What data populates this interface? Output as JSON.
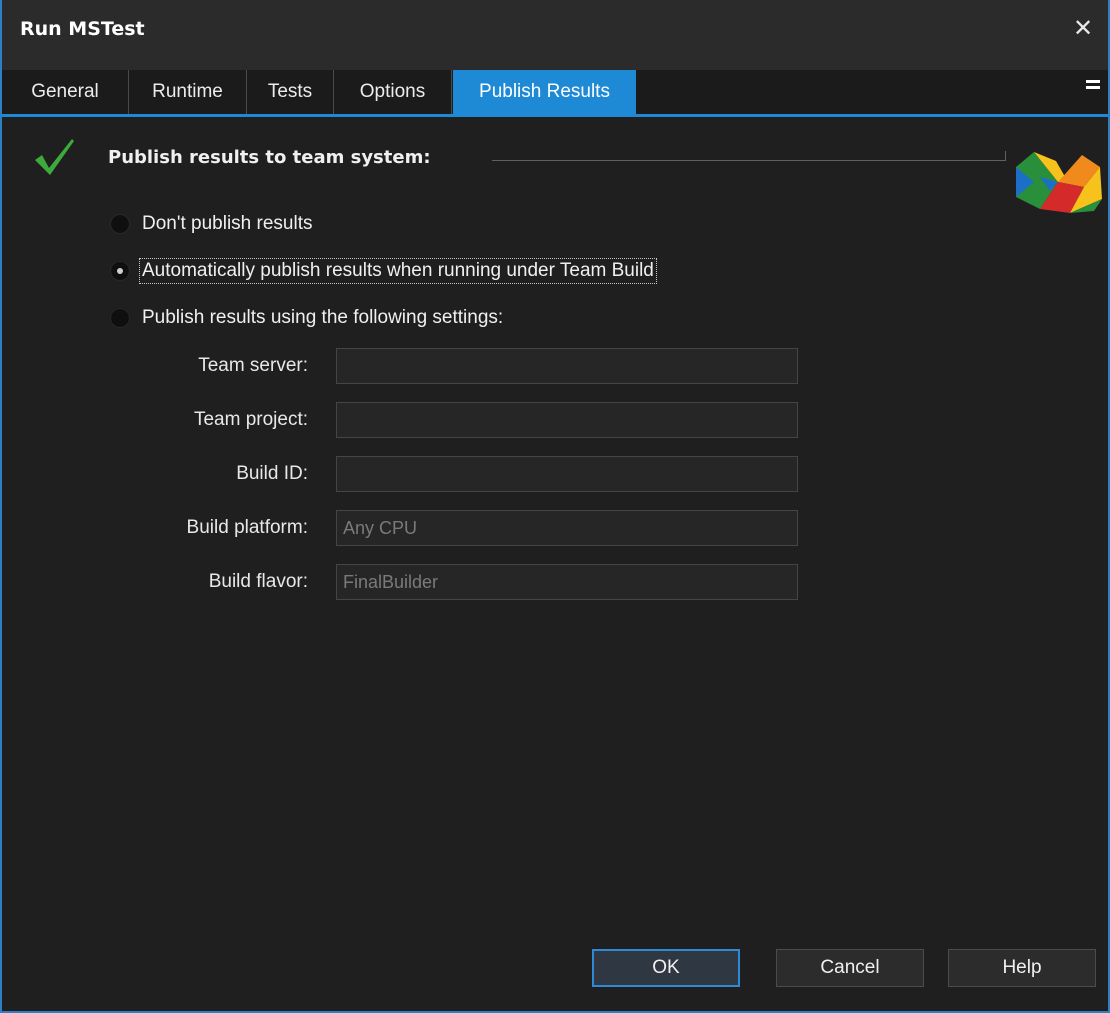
{
  "window": {
    "title": "Run MSTest"
  },
  "tabs": [
    {
      "label": "General"
    },
    {
      "label": "Runtime"
    },
    {
      "label": "Tests"
    },
    {
      "label": "Options"
    },
    {
      "label": "Publish Results",
      "active": true
    }
  ],
  "section": {
    "title": "Publish results to team system:"
  },
  "options": [
    {
      "label": "Don't publish results",
      "checked": false
    },
    {
      "label": "Automatically publish results when running under Team Build",
      "checked": true
    },
    {
      "label": "Publish results using the following settings:",
      "checked": false
    }
  ],
  "fields": [
    {
      "label": "Team server:",
      "value": ""
    },
    {
      "label": "Team project:",
      "value": ""
    },
    {
      "label": "Build ID:",
      "value": ""
    },
    {
      "label": "Build platform:",
      "value": "Any CPU"
    },
    {
      "label": "Build flavor:",
      "value": "FinalBuilder"
    }
  ],
  "buttons": {
    "ok": "OK",
    "cancel": "Cancel",
    "help": "Help"
  },
  "icons": {
    "close": "close-icon",
    "overflow": "tab-overflow-icon",
    "status": "checkmark-icon",
    "logo": "visual-studio-logo-icon"
  },
  "colors": {
    "accent": "#1e8ad6",
    "background": "#1f1f1f",
    "check": "#3cab3c"
  }
}
